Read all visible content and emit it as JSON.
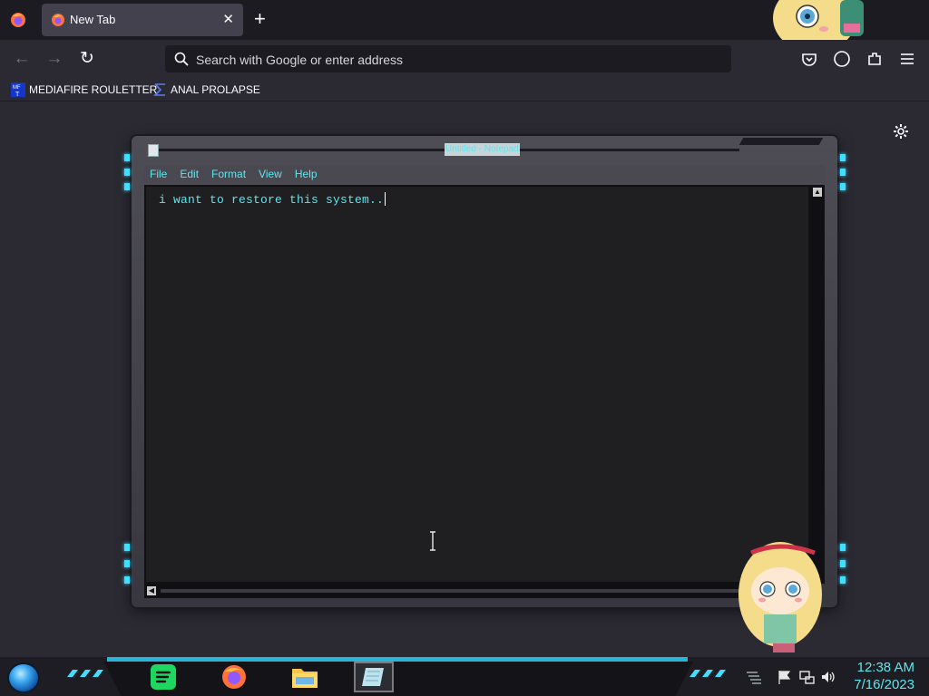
{
  "browser": {
    "tab": {
      "title": "New Tab",
      "close": "✕"
    },
    "new_tab": "+",
    "nav": {
      "back": "←",
      "forward": "→",
      "reload": "↻"
    },
    "urlbar": {
      "placeholder": "Search with Google or enter address"
    },
    "bookmarks": [
      {
        "label": "MEDIAFIRE ROULETTER",
        "icon": "mediafire-icon"
      },
      {
        "label": "ANAL PROLAPSE",
        "icon": "bookmark-sigma-icon"
      }
    ]
  },
  "notepad": {
    "title": "Untitled - Notepad",
    "menu": [
      "File",
      "Edit",
      "Format",
      "View",
      "Help"
    ],
    "content": "i want to restore this system..",
    "accent_color": "#5ee6ee"
  },
  "taskbar": {
    "apps": [
      "spotify-icon",
      "firefox-icon",
      "file-explorer-icon",
      "notepad-icon"
    ],
    "tray": [
      "action-center-flag-icon",
      "network-icon",
      "volume-icon"
    ],
    "clock": {
      "time": "12:38 AM",
      "date": "7/16/2023"
    }
  },
  "colors": {
    "chrome_bg": "#1c1b22",
    "content_bg": "#2b2a33",
    "cyan": "#5ee6ee",
    "taskbar_strip": "#27b5d9"
  }
}
